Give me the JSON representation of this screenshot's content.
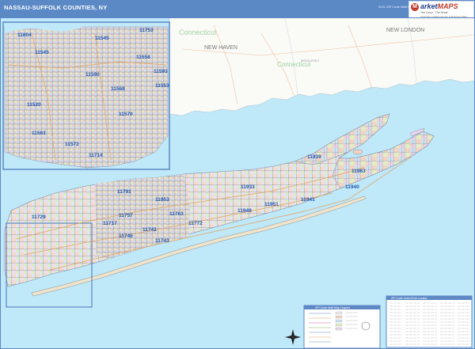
{
  "header": {
    "title": "NASSAU-SUFFOLK COUNTIES, NY",
    "edition": "2021 ZIP Code Wall Map",
    "logo_mark": "M",
    "logo_word_a": "arket",
    "logo_word_b": "MAPS",
    "logo_tagline": "The Good · The Great",
    "logo_subline": "America's Leading Source of Business Maps"
  },
  "map": {
    "colors": {
      "water": "#bfe8f8",
      "land_ct": "#fafaf7",
      "border": "#5e88c5"
    },
    "state_labels": [
      "Connecticut"
    ],
    "place_labels": [
      "NEW HAVEN",
      "NEW LONDON",
      "MIDDLESEX"
    ],
    "zip_labels_inset": [
      "11804",
      "11545",
      "11753",
      "11545",
      "11558",
      "11590",
      "11593",
      "11568",
      "11553",
      "11520",
      "11570",
      "11563",
      "11572",
      "11714"
    ],
    "zip_labels_main": [
      "11939",
      "11963",
      "11933",
      "11791",
      "11953",
      "11941",
      "11949",
      "11951",
      "11763",
      "11772",
      "11757",
      "11717",
      "11742",
      "11729",
      "11940",
      "11746",
      "11743"
    ],
    "legend_title": "ZIP Code Wall Map Legend",
    "index_title": "ZIP Code Index/Grid Locator"
  }
}
